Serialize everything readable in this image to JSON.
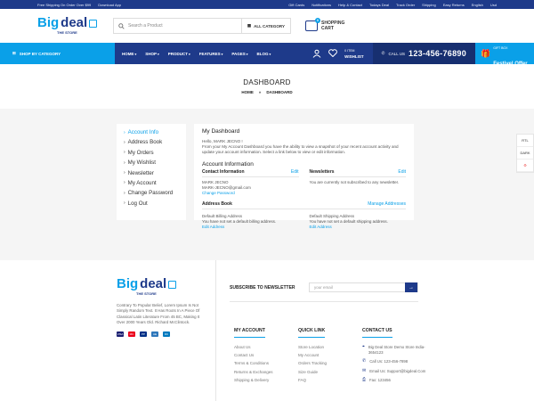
{
  "topbar": {
    "left": [
      "Free Shipping On Order Over $99",
      "Download App"
    ],
    "right": [
      "Gift Cards",
      "Notifications",
      "Help & Contact",
      "Todays Deal",
      "Track Order",
      "Shipping",
      "Easy Returns",
      "English",
      "Usd"
    ]
  },
  "logo": {
    "big1": "Big",
    "big2": "deal",
    "sub": "THE STORE"
  },
  "search": {
    "placeholder": "Search a Product",
    "category": "ALL CATEGORY"
  },
  "cart": {
    "line1": "SHOPPING",
    "line2": "CART",
    "count": "0"
  },
  "nav": {
    "shop_by_category": "SHOP BY CATEGORY",
    "menu": [
      "HOME",
      "SHOP",
      "PRODUCT",
      "FEATURES",
      "PAGES",
      "BLOG"
    ],
    "wishlist_count": "0 ITEM",
    "wishlist_label": "WISHLIST",
    "call_label": "CALL US",
    "phone": "123-456-76890",
    "gift_line1": "GIFT BOX",
    "gift_line2": "Festivel Offer"
  },
  "banner": {
    "title": "DASHBOARD",
    "crumb_home": "HOME",
    "crumb_sep": "»",
    "crumb_current": "DASHBOARD"
  },
  "sidebar": {
    "items": [
      {
        "label": "Account Info"
      },
      {
        "label": "Address Book"
      },
      {
        "label": "My Orders"
      },
      {
        "label": "My Wishlist"
      },
      {
        "label": "Newsletter"
      },
      {
        "label": "My Account"
      },
      {
        "label": "Change Password"
      },
      {
        "label": "Log Out"
      }
    ]
  },
  "dashboard": {
    "title": "My Dashboard",
    "hello": "Hello, MARK JECNO !",
    "intro": "From your My Account Dashboard you have the ability to view a snapshot of your recent account activity and update your account information. Select a link below to view or edit information.",
    "account_info_title": "Account Information",
    "contact": {
      "title": "Contact Information",
      "edit": "Edit",
      "name": "MARK JECNO",
      "email": "MARK-JECNO@gmail.com",
      "change": "Change Password"
    },
    "newsletters": {
      "title": "Newsletters",
      "edit": "Edit",
      "text": "You are currently not subscribed to any newsletter."
    },
    "address_book": {
      "title": "Address Book",
      "manage": "Manage Addresses"
    },
    "billing": {
      "title": "Default Billing Address",
      "text": "You have not set a default billing address.",
      "edit": "Edit Address"
    },
    "shipping": {
      "title": "Default Shipping Address",
      "text": "You have not set a default shipping address.",
      "edit": "Edit Address"
    }
  },
  "floating": {
    "rtl": "RTL",
    "dark": "DARK"
  },
  "footer": {
    "desc": "Contrary To Popular Belief, Lorem Ipsum Is Not Simply Random Text. It Has Roots In A Piece Of Classical Latin Literature From 45 BC, Making It Over 2000 Years Old. Richard McClintock.",
    "pay": [
      "VISA",
      "MC",
      "PP",
      "AE",
      "DC"
    ],
    "newsletter_label": "SUBSCRIBE TO NEWSLETTER",
    "email_placeholder": "your email",
    "my_account": {
      "title": "MY ACCOUNT",
      "links": [
        "About Us",
        "Contact Us",
        "Terms & Conditions",
        "Returns & Exchanges",
        "Shipping & Delivery"
      ]
    },
    "quick_link": {
      "title": "QUICK LINK",
      "links": [
        "Store Location",
        "My Account",
        "Orders Tracking",
        "Size Guide",
        "FAQ"
      ]
    },
    "contact_us": {
      "title": "CONTACT US",
      "address": "Big Deal Store Demo Store India-3654123",
      "call": "Call Us: 123-456-7898",
      "email": "Email Us: Support@bigdeal.Com",
      "fax": "Fax: 123456"
    }
  },
  "colors": {
    "primary": "#1e3a8a",
    "accent": "#0aa0e8"
  }
}
